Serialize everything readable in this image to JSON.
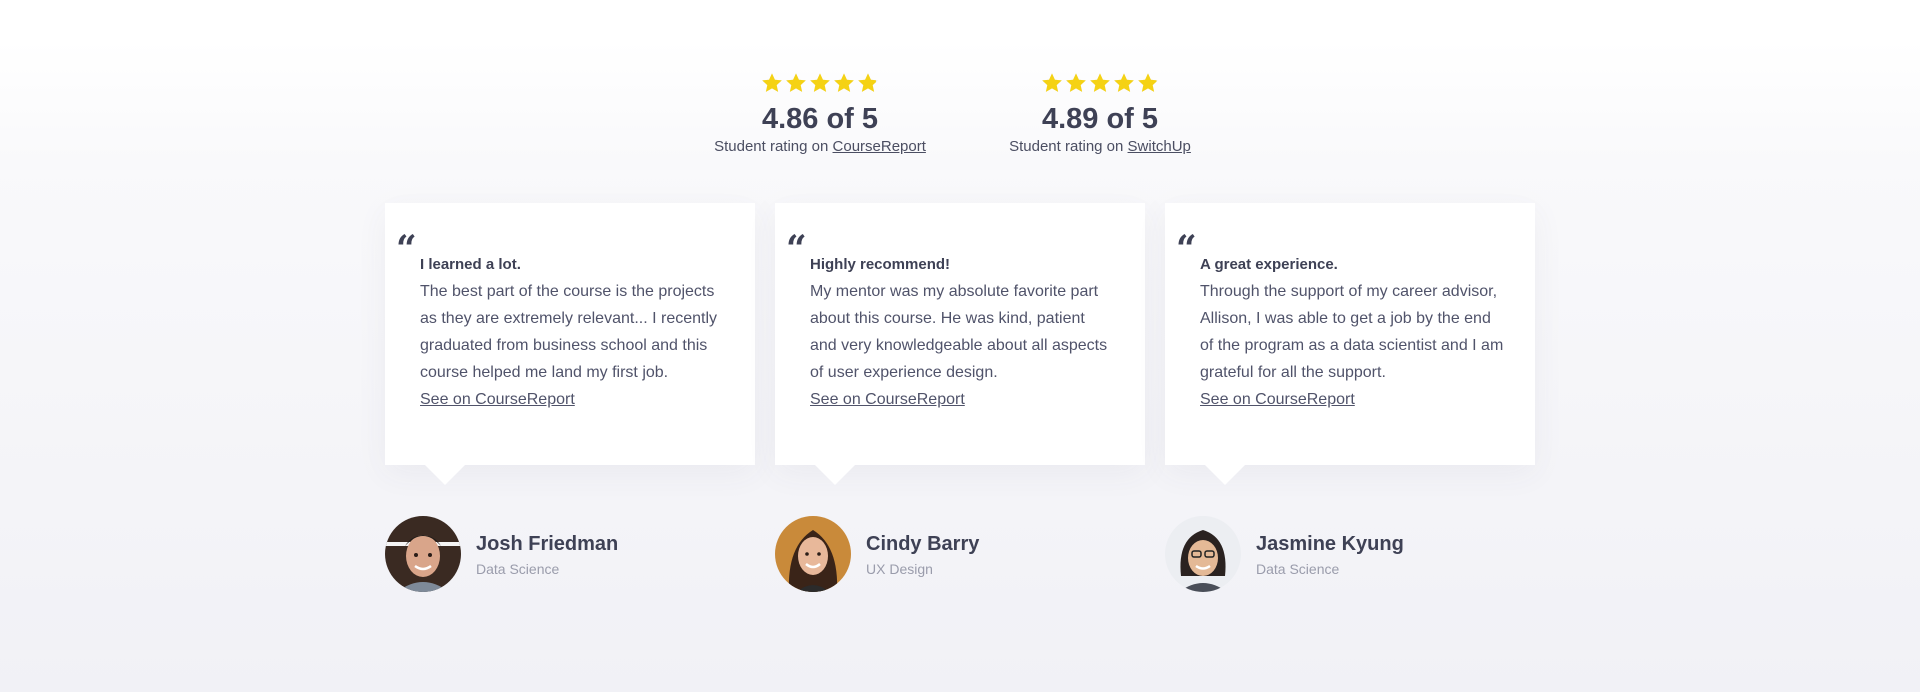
{
  "ratings": [
    {
      "score": "4.86 of 5",
      "prefix": "Student rating on ",
      "source": "CourseReport",
      "stars": 4.86
    },
    {
      "score": "4.89 of 5",
      "prefix": "Student rating on ",
      "source": "SwitchUp",
      "stars": 4.89
    }
  ],
  "colors": {
    "star": "#f5d214",
    "text": "#3e4155",
    "muted": "#9a9cab"
  },
  "testimonials": [
    {
      "title": "I learned a lot.",
      "body": "The best part of the course is the projects as they are extremely relevant... I recently graduated from business school and this course helped me land my first job.",
      "link": "See on CourseReport",
      "name": "Josh Friedman",
      "track": "Data Science"
    },
    {
      "title": "Highly recommend!",
      "body": "My mentor was my absolute favorite part about this course. He was kind, patient and very knowledgeable about all aspects of user experience design.",
      "link": "See on CourseReport",
      "name": "Cindy Barry",
      "track": "UX Design"
    },
    {
      "title": "A great experience.",
      "body": "Through the support of my career advisor, Allison, I was able to get a job by the end of the program as a data scientist and I am grateful for all the support.",
      "link": "See on CourseReport",
      "name": "Jasmine Kyung",
      "track": "Data Science"
    }
  ]
}
